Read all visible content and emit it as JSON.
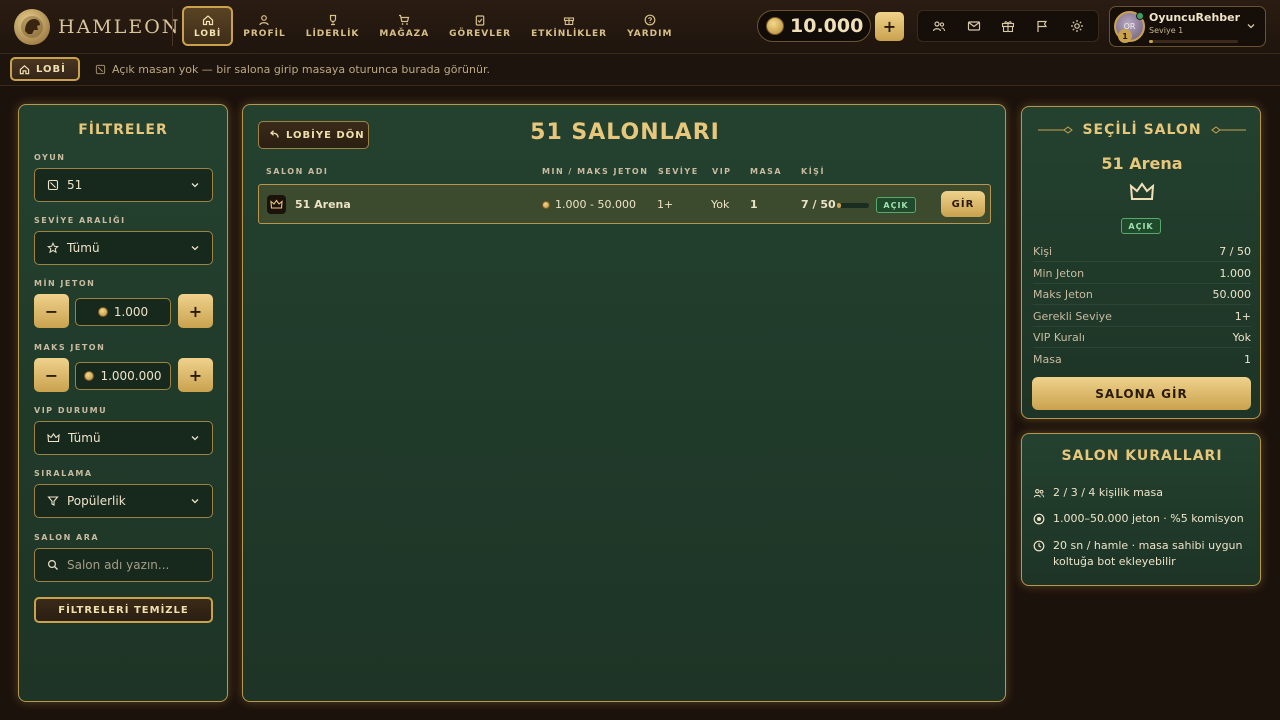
{
  "brand": {
    "name": "HAMLEON"
  },
  "nav": [
    {
      "label": "LOBİ",
      "icon": "home-icon",
      "active": true
    },
    {
      "label": "PROFİL",
      "icon": "user-icon"
    },
    {
      "label": "LİDERLİK",
      "icon": "trophy-icon"
    },
    {
      "label": "MAĞAZA",
      "icon": "cart-icon"
    },
    {
      "label": "GÖREVLER",
      "icon": "clipboard-icon"
    },
    {
      "label": "ETKİNLİKLER",
      "icon": "gift-icon"
    },
    {
      "label": "YARDIM",
      "icon": "help-icon"
    }
  ],
  "wallet": {
    "balance": "10.000",
    "add_label": "+"
  },
  "header_icons": [
    "friends-icon",
    "mail-icon",
    "gift-icon",
    "flag-icon",
    "settings-icon"
  ],
  "user": {
    "name": "OyuncuRehber",
    "level_text": "Seviye 1",
    "avatar_initials": "OR",
    "level_badge": "1",
    "xp_progress": 0.05
  },
  "subbar": {
    "chip_label": "LOBİ",
    "message": "Açık masan yok — bir salona girip masaya oturunca burada görünür."
  },
  "filters": {
    "title": "FİLTRELER",
    "game_label": "OYUN",
    "game_value": "51",
    "level_label": "SEVİYE ARALIĞI",
    "level_value": "Tümü",
    "min_label": "MİN JETON",
    "min_value": "1.000",
    "max_label": "MAKS JETON",
    "max_value": "1.000.000",
    "minus": "−",
    "plus": "+",
    "vip_label": "VIP DURUMU",
    "vip_value": "Tümü",
    "sort_label": "SIRALAMA",
    "sort_value": "Popülerlik",
    "search_label": "SALON ARA",
    "search_placeholder": "Salon adı yazın...",
    "clear_label": "FİLTRELERİ TEMİZLE"
  },
  "main": {
    "back_label": "LOBİYE DÖN",
    "title": "51 SALONLARI",
    "columns": {
      "name": "SALON ADI",
      "range": "MIN / MAKS JETON",
      "level": "SEVİYE",
      "vip": "VIP",
      "tables": "MASA",
      "players": "KİŞİ"
    },
    "rows": [
      {
        "name": "51 Arena",
        "range": "1.000 - 50.000",
        "level": "1+",
        "vip": "Yok",
        "tables": "1",
        "players": "7 / 50",
        "occupancy": 0.14,
        "status": "AÇIK",
        "action": "GİR"
      }
    ]
  },
  "selected": {
    "title": "SEÇİLİ SALON",
    "name": "51 Arena",
    "status": "AÇIK",
    "rows": [
      {
        "k": "Kişi",
        "v": "7 / 50"
      },
      {
        "k": "Min Jeton",
        "v": "1.000"
      },
      {
        "k": "Maks Jeton",
        "v": "50.000"
      },
      {
        "k": "Gerekli Seviye",
        "v": "1+"
      },
      {
        "k": "VIP Kuralı",
        "v": "Yok"
      },
      {
        "k": "Masa",
        "v": "1"
      }
    ],
    "button": "SALONA GİR"
  },
  "rules": {
    "title": "SALON KURALLARI",
    "items": [
      {
        "icon": "users-icon",
        "text": "2 / 3 / 4 kişilik masa"
      },
      {
        "icon": "coin-icon",
        "text": "1.000–50.000 jeton · %5 komisyon"
      },
      {
        "icon": "clock-icon",
        "text": "20 sn / hamle · masa sahibi uygun koltuğa bot ekleyebilir"
      }
    ]
  },
  "colors": {
    "gold": "#c9a24e",
    "panel": "#24412f",
    "background": "#1c120c",
    "open_green": "#58a86e"
  }
}
